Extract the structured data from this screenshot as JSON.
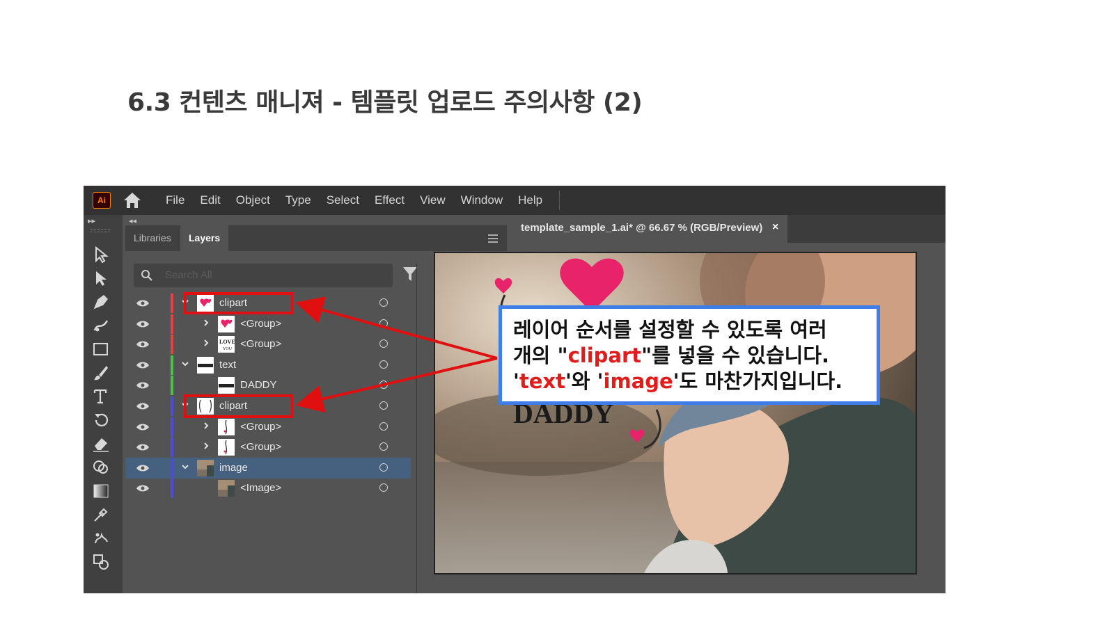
{
  "slide": {
    "title": "6.3 컨텐츠 매니져 - 템플릿 업로드 주의사항 (2)"
  },
  "app": {
    "logo": "Ai",
    "menu": [
      "File",
      "Edit",
      "Object",
      "Type",
      "Select",
      "Effect",
      "View",
      "Window",
      "Help"
    ],
    "tools": [
      "selection-tool",
      "direct-selection-tool",
      "pen-tool",
      "curvature-tool",
      "rectangle-tool",
      "paintbrush-tool",
      "type-tool",
      "rotate-tool",
      "eraser-tool",
      "shape-builder-tool",
      "gradient-tool",
      "eyedropper-tool",
      "puppet-warp-tool",
      "artboard-tool"
    ]
  },
  "panel": {
    "tabs": [
      "Libraries",
      "Layers"
    ],
    "active_tab": "Layers",
    "search_placeholder": "Search All",
    "layers": [
      {
        "name": "clipart",
        "level": 0,
        "expanded": true,
        "color": "#e0453f",
        "thumb": "heart"
      },
      {
        "name": "<Group>",
        "level": 1,
        "expanded": false,
        "color": "#e0453f",
        "thumb": "heart"
      },
      {
        "name": "<Group>",
        "level": 1,
        "expanded": false,
        "color": "#e0453f",
        "thumb": "love"
      },
      {
        "name": "text",
        "level": 0,
        "expanded": true,
        "color": "#47c44b",
        "thumb": "daddy"
      },
      {
        "name": "DADDY",
        "level": 1,
        "expanded": null,
        "color": "#47c44b",
        "thumb": "daddy"
      },
      {
        "name": "clipart",
        "level": 0,
        "expanded": true,
        "color": "#4c4cd6",
        "thumb": "frame"
      },
      {
        "name": "<Group>",
        "level": 1,
        "expanded": false,
        "color": "#4c4cd6",
        "thumb": "vine"
      },
      {
        "name": "<Group>",
        "level": 1,
        "expanded": false,
        "color": "#4c4cd6",
        "thumb": "vine"
      },
      {
        "name": "image",
        "level": 0,
        "expanded": true,
        "color": "#4c4cd6",
        "thumb": "photo",
        "selected": true
      },
      {
        "name": "<Image>",
        "level": 1,
        "expanded": null,
        "color": "#4c4cd6",
        "thumb": "photo"
      }
    ]
  },
  "document": {
    "tab_title": "template_sample_1.ai* @ 66.67 % (RGB/Preview)",
    "close": "×",
    "artwork_text": "DADDY"
  },
  "callout": {
    "line1": "레이어 순서를 설정할 수 있도록 여러",
    "line2_a": "개의 \"",
    "line2_red": "clipart",
    "line2_b": "\"를 넣을 수 있습니다.",
    "line3_q1": "'",
    "line3_red1": "text",
    "line3_a": "'와 '",
    "line3_red2": "image",
    "line3_b": "'도 마찬가지입니다."
  },
  "colors": {
    "annotation_red": "#e01010",
    "callout_border": "#3f7ee8",
    "heart_pink": "#e8236a"
  }
}
